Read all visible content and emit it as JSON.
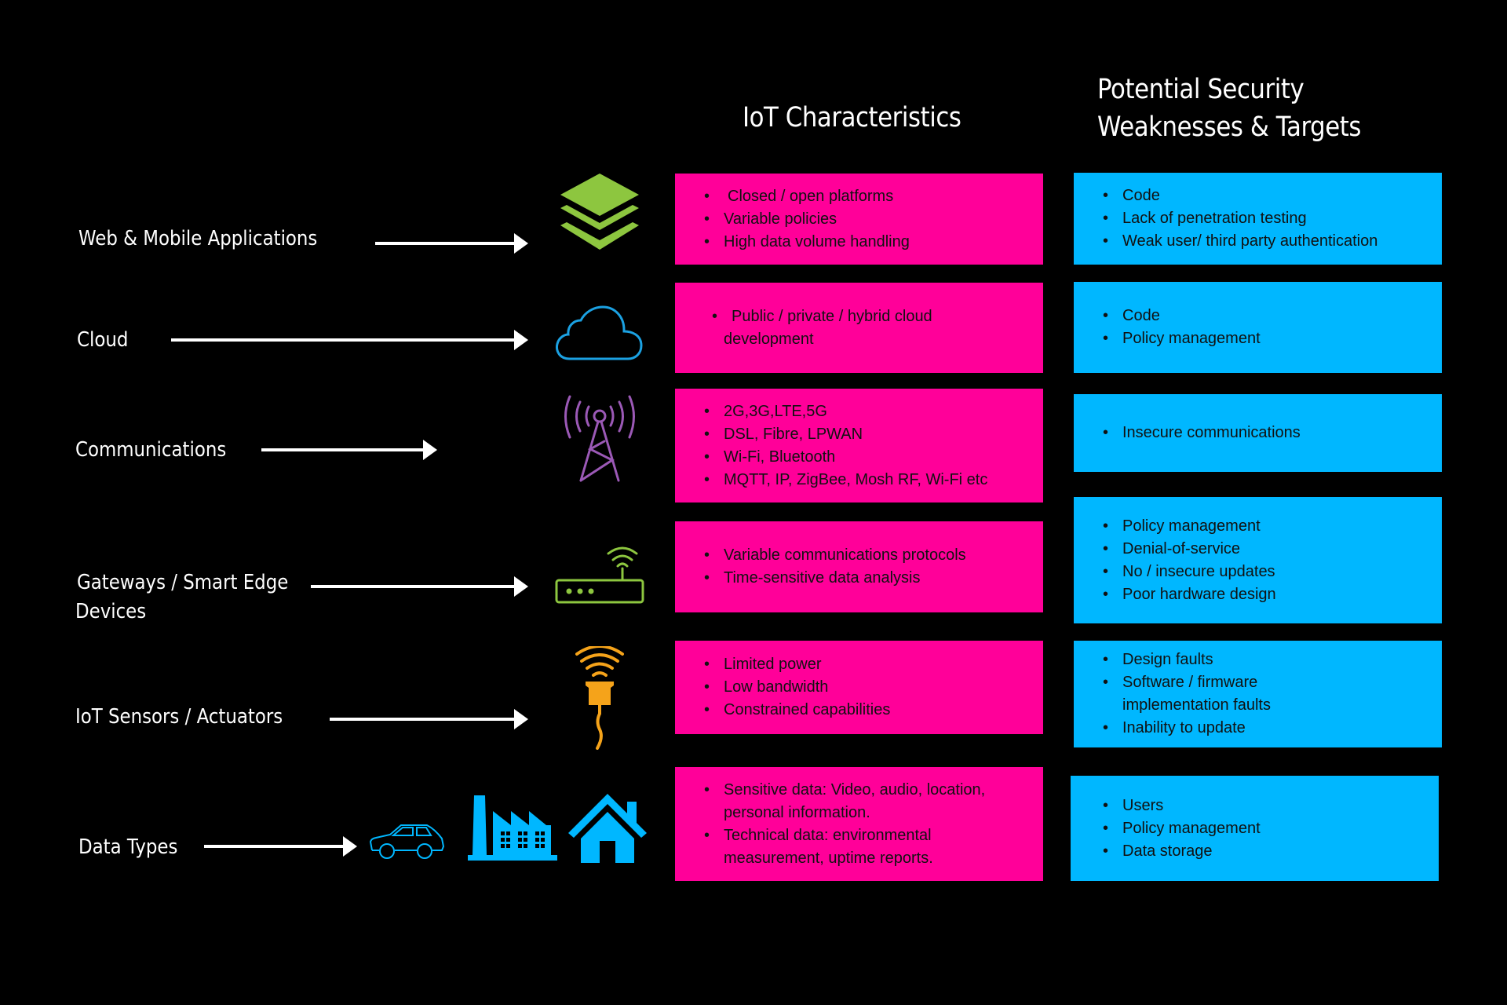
{
  "headers": {
    "characteristics": "IoT Characteristics",
    "weaknesses_line1": "Potential Security",
    "weaknesses_line2": "Weaknesses & Targets"
  },
  "colors": {
    "characteristics_box": "#ff0099",
    "weaknesses_box": "#00b7ff",
    "background": "#000000",
    "layers_icon": "#8dc63f",
    "cloud_icon": "#1ba1e2",
    "tower_icon": "#9b59b6",
    "router_icon": "#8dc63f",
    "sensor_icon": "#f5a31a",
    "data_icons": "#00b7ff"
  },
  "rows": [
    {
      "label": "Web & Mobile Applications",
      "icon": "layers-icon",
      "characteristics": [
        "Closed / open platforms",
        "Variable policies",
        "High data volume handling"
      ],
      "weaknesses": [
        "Code",
        "Lack of penetration testing",
        "Weak user/ third party authentication"
      ]
    },
    {
      "label": "Cloud",
      "icon": "cloud-icon",
      "characteristics": [
        "Public / private / hybrid cloud development"
      ],
      "weaknesses": [
        "Code",
        "Policy management"
      ]
    },
    {
      "label": "Communications",
      "icon": "cell-tower-icon",
      "characteristics": [
        "2G,3G,LTE,5G",
        "DSL, Fibre, LPWAN",
        "Wi-Fi, Bluetooth",
        "MQTT, IP, ZigBee, Mosh RF, Wi-Fi etc"
      ],
      "weaknesses": [
        "Insecure communications"
      ]
    },
    {
      "label_line1": "Gateways / Smart Edge",
      "label_line2": "Devices",
      "icon": "router-icon",
      "characteristics": [
        "Variable communications protocols",
        "Time-sensitive data analysis"
      ],
      "weaknesses": [
        "Policy management",
        "Denial-of-service",
        "No / insecure updates",
        "Poor hardware design"
      ]
    },
    {
      "label": "IoT Sensors / Actuators",
      "icon": "sensor-icon",
      "characteristics": [
        "Limited power",
        "Low bandwidth",
        "Constrained capabilities"
      ],
      "weaknesses": [
        "Design faults",
        "Software / firmware implementation faults",
        "Inability to update"
      ]
    },
    {
      "label": "Data Types",
      "icons": [
        "car-icon",
        "factory-icon",
        "house-icon"
      ],
      "characteristics": [
        "Sensitive data: Video, audio, location, personal information.",
        "Technical data: environmental measurement, uptime reports."
      ],
      "weaknesses": [
        "Users",
        "Policy management",
        "Data storage"
      ]
    }
  ]
}
